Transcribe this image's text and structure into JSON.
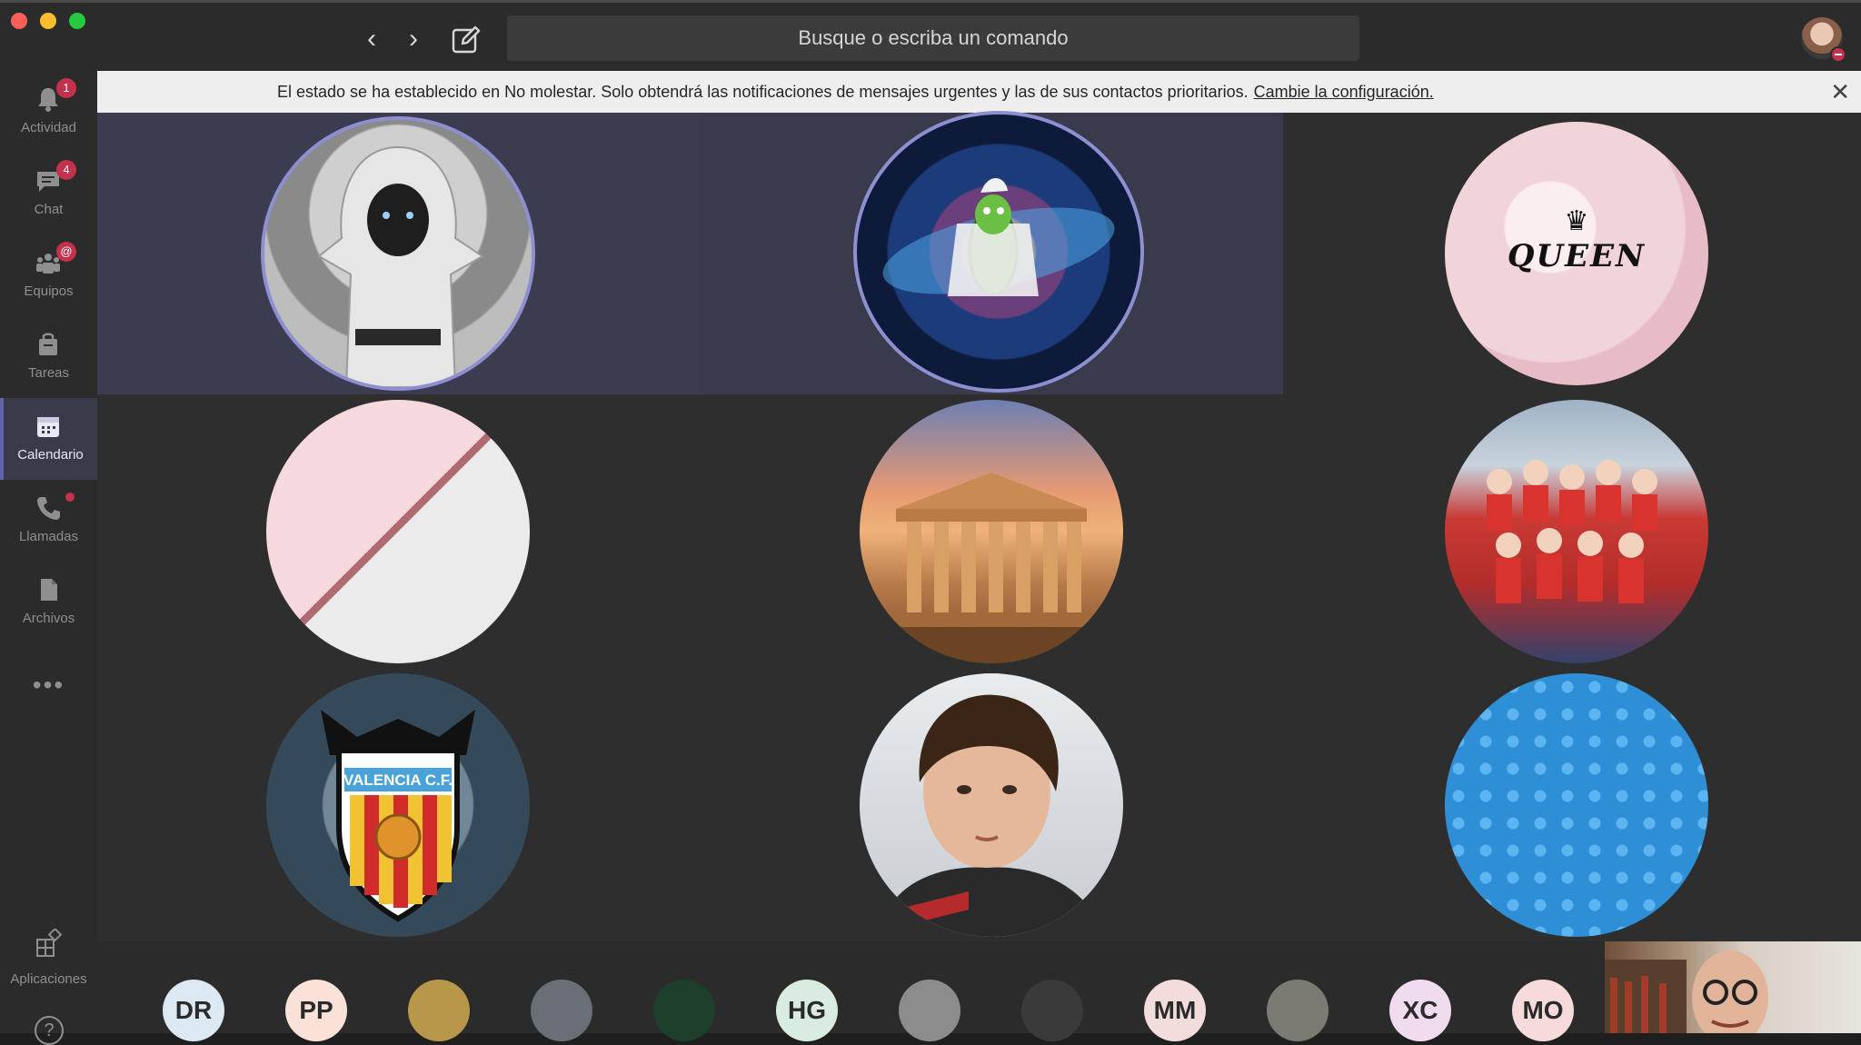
{
  "search": {
    "placeholder": "Busque o escriba un comando"
  },
  "nav": {
    "back_icon": "chevron-left-icon",
    "forward_icon": "chevron-right-icon",
    "compose_icon": "compose-icon"
  },
  "sidebar": {
    "items": [
      {
        "label": "Actividad",
        "icon": "bell-icon",
        "badge": "1"
      },
      {
        "label": "Chat",
        "icon": "chat-icon",
        "badge": "4"
      },
      {
        "label": "Equipos",
        "icon": "teams-icon",
        "badge": "@"
      },
      {
        "label": "Tareas",
        "icon": "bag-icon",
        "badge": ""
      },
      {
        "label": "Calendario",
        "icon": "calendar-icon",
        "badge": ""
      },
      {
        "label": "Llamadas",
        "icon": "phone-icon",
        "badge": ""
      },
      {
        "label": "Archivos",
        "icon": "file-icon",
        "badge": ""
      }
    ],
    "more": "•••",
    "apps_label": "Aplicaciones",
    "help": "?"
  },
  "notice": {
    "text": "El estado se ha establecido en No molestar. Solo obtendrá las notificaciones de mensajes urgentes y las de sus contactos prioritarios.",
    "link": "Cambie la configuración.",
    "close": "✕"
  },
  "grid": {
    "tiles": [
      {
        "image": "hooded-figure-avatar"
      },
      {
        "image": "galaxy-pickle-avatar"
      },
      {
        "image": "queen-fur-avatar",
        "text": "QUEEN",
        "crown": "♛"
      },
      {
        "image": "pink-marble-avatar"
      },
      {
        "image": "parthenon-avatar"
      },
      {
        "image": "football-team-avatar"
      },
      {
        "image": "valencia-cf-avatar",
        "text": "VALENCIA C.F."
      },
      {
        "image": "boy-photo-avatar"
      },
      {
        "image": "blue-stars-avatar"
      }
    ]
  },
  "strip": {
    "participants": [
      {
        "initials": "DR",
        "color": "#dce8f2"
      },
      {
        "initials": "PP",
        "color": "#fbe2d8"
      },
      {
        "initials": "",
        "color": "#b7984a"
      },
      {
        "initials": "",
        "color": "#6a6f76"
      },
      {
        "initials": "",
        "color": "#1d3f2a"
      },
      {
        "initials": "HG",
        "color": "#d9ece2"
      },
      {
        "initials": "",
        "color": "#8c8c8c"
      },
      {
        "initials": "",
        "color": "#3a3a3a"
      },
      {
        "initials": "MM",
        "color": "#f3dcdc"
      },
      {
        "initials": "",
        "color": "#7b7a73"
      },
      {
        "initials": "XC",
        "color": "#f1dcef"
      },
      {
        "initials": "MO",
        "color": "#f7dada"
      }
    ]
  }
}
